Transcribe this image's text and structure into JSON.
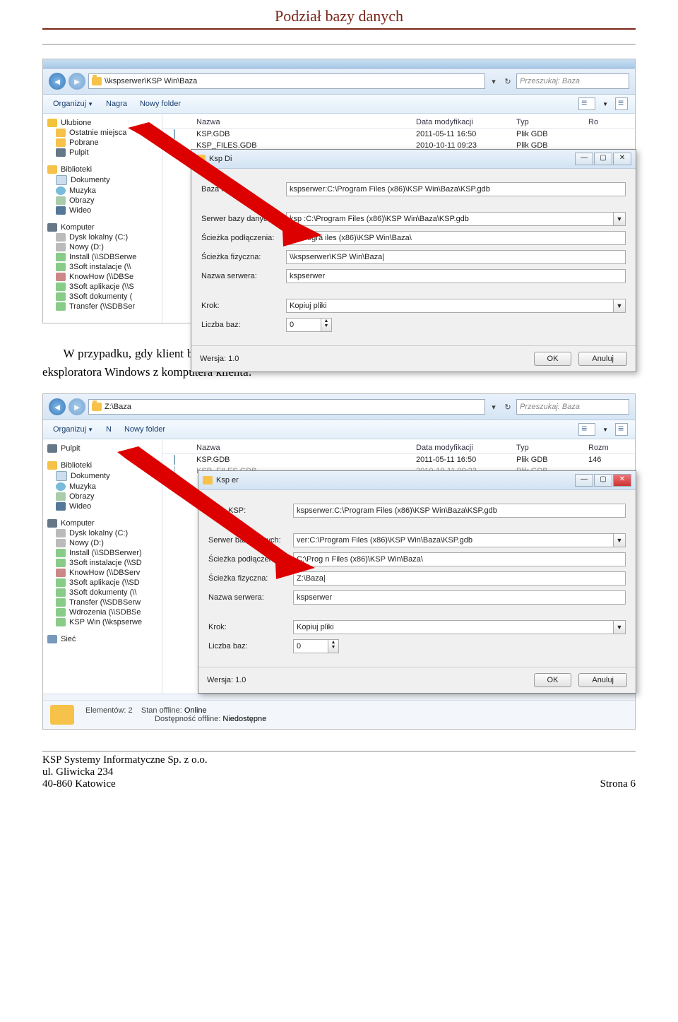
{
  "header": "Podział bazy danych",
  "s1": {
    "addr": "\\\\kspserwer\\KSP Win\\Baza",
    "search": "Przeszukaj: Baza",
    "toolbar": {
      "org": "Organizuj",
      "burn": "Nagra",
      "newf": "Nowy folder"
    },
    "cols": {
      "name": "Nazwa",
      "date": "Data modyfikacji",
      "type": "Typ",
      "size": "Ro"
    },
    "rows": [
      {
        "n": "KSP.GDB",
        "d": "2011-05-11 16:50",
        "t": "Plik GDB"
      },
      {
        "n": "KSP_FILES.GDB",
        "d": "2010-10-11 09:23",
        "t": "Plik GDB"
      }
    ],
    "side": {
      "fav": "Ulubione",
      "recent": "Ostatnie miejsca",
      "dl": "Pobrane",
      "desk": "Pulpit",
      "lib": "Biblioteki",
      "docs": "Dokumenty",
      "mus": "Muzyka",
      "pic": "Obrazy",
      "vid": "Wideo",
      "comp": "Komputer",
      "c": "Dysk lokalny (C:)",
      "d": "Nowy (D:)",
      "n1": "Install (\\\\SDBSerwe",
      "n2": "3Soft instalacje (\\\\",
      "n3": "KnowHow (\\\\DBSe",
      "n4": "3Soft aplikacje (\\\\S",
      "n5": "3Soft dokumenty (",
      "n6": "Transfer (\\\\SDBSer"
    },
    "dlg": {
      "title": "Ksp Di",
      "f": {
        "baza": "Baza KSP:",
        "srv": "Serwer bazy danych:",
        "conn": "Ścieżka podłączenia:",
        "phys": "Ścieżka fizyczna:",
        "name": "Nazwa serwera:",
        "step": "Krok:",
        "cnt": "Liczba baz:"
      },
      "v": {
        "baza": "kspserwer:C:\\Program Files (x86)\\KSP Win\\Baza\\KSP.gdb",
        "srv": "ksp       :C:\\Program Files (x86)\\KSP Win\\Baza\\KSP.gdb",
        "conn": "C:\\Progra    iles (x86)\\KSP Win\\Baza\\",
        "phys": "\\\\kspserwer\\KSP Win\\Baza|",
        "name": "kspserwer",
        "step": "Kopiuj pliki",
        "cnt": "0"
      },
      "ver": "Wersja:  1.0",
      "ok": "OK",
      "cancel": "Anuluj"
    }
  },
  "para": "W przypadku, gdy klient będzie się łączył poprzez zasoby zmapowane, podobnie wystarczy taką ścieżkę skopiować z eksploratora Windows z komputera klienta:",
  "s2": {
    "addr": "Z:\\Baza",
    "search": "Przeszukaj: Baza",
    "toolbar": {
      "org": "Organizuj",
      "burn": "N",
      "newf": "Nowy folder"
    },
    "cols": {
      "name": "Nazwa",
      "date": "Data modyfikacji",
      "type": "Typ",
      "size": "Rozm"
    },
    "rows": [
      {
        "n": "KSP.GDB",
        "d": "2011-05-11 16:50",
        "t": "Plik GDB",
        "s": "146"
      },
      {
        "n": "KSP_FILES.GDB",
        "d": "2010-10-11 09:23",
        "t": "Plik GDB",
        "s": ""
      }
    ],
    "side": {
      "desk": "Pulpit",
      "lib": "Biblioteki",
      "docs": "Dokumenty",
      "mus": "Muzyka",
      "pic": "Obrazy",
      "vid": "Wideo",
      "comp": "Komputer",
      "c": "Dysk lokalny (C:)",
      "d": "Nowy (D:)",
      "n1": "Install (\\\\SDBSerwer)",
      "n2": "3Soft instalacje (\\\\SD",
      "n3": "KnowHow (\\\\DBServ",
      "n4": "3Soft aplikacje (\\\\SD",
      "n5": "3Soft dokumenty (\\\\",
      "n6": "Transfer (\\\\SDBSerw",
      "n7": "Wdrozenia (\\\\SDBSe",
      "n8": "KSP Win (\\\\kspserwe",
      "net": "Sieć"
    },
    "dlg": {
      "title": "Ksp    er",
      "f": {
        "baza": "Baza KSP:",
        "srv": "Serwer bazy danych:",
        "conn": "Ścieżka podłączenia:",
        "phys": "Ścieżka fizyczna:",
        "name": "Nazwa serwera:",
        "step": "Krok:",
        "cnt": "Liczba baz:"
      },
      "v": {
        "baza": "kspserwer:C:\\Program Files (x86)\\KSP Win\\Baza\\KSP.gdb",
        "srv": "   ver:C:\\Program Files (x86)\\KSP Win\\Baza\\KSP.gdb",
        "conn": "C:\\Prog    n Files (x86)\\KSP Win\\Baza\\",
        "phys": "Z:\\Baza|",
        "name": "kspserwer",
        "step": "Kopiuj pliki",
        "cnt": "0"
      },
      "ver": "Wersja:  1.0",
      "ok": "OK",
      "cancel": "Anuluj"
    },
    "status": {
      "count": "Elementów: 2",
      "off1": "Stan offline:",
      "off1v": "Online",
      "off2": "Dostępność offline:",
      "off2v": "Niedostępne"
    }
  },
  "footer": {
    "l1": "KSP Systemy Informatyczne Sp. z o.o.",
    "l2": "ul. Gliwicka 234",
    "l3": "40-860 Katowice",
    "page": "Strona 6"
  }
}
